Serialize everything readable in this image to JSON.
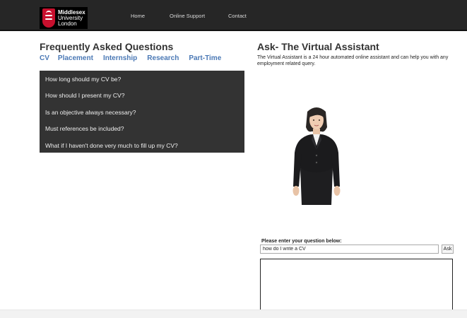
{
  "header": {
    "logo_lines": [
      "Middlesex",
      "University",
      "London"
    ],
    "nav": [
      "Home",
      "Online Support",
      "Contact"
    ]
  },
  "faq": {
    "title": "Frequently Asked Questions",
    "tabs": [
      "CV",
      "Placement",
      "Internship",
      "Research",
      "Part-Time"
    ],
    "questions": [
      "How long should my CV be?",
      "How should I present my CV?",
      "Is an objective always necessary?",
      "Must references be included?",
      "What if I haven't done very much to fill up my CV?"
    ]
  },
  "assistant": {
    "title": "Ask- The Virtual Assistant",
    "description": "The Virtual Assistant is a 24 hour automated online assistant and can help you with any employment related query.",
    "question_label": "Please enter your question below:",
    "question_value": "how do I write a CV",
    "ask_label": "Ask"
  },
  "colors": {
    "topbar": "#262626",
    "faq_panel": "#333333",
    "link_blue": "#4a78b5",
    "brand_red": "#c8102e"
  }
}
